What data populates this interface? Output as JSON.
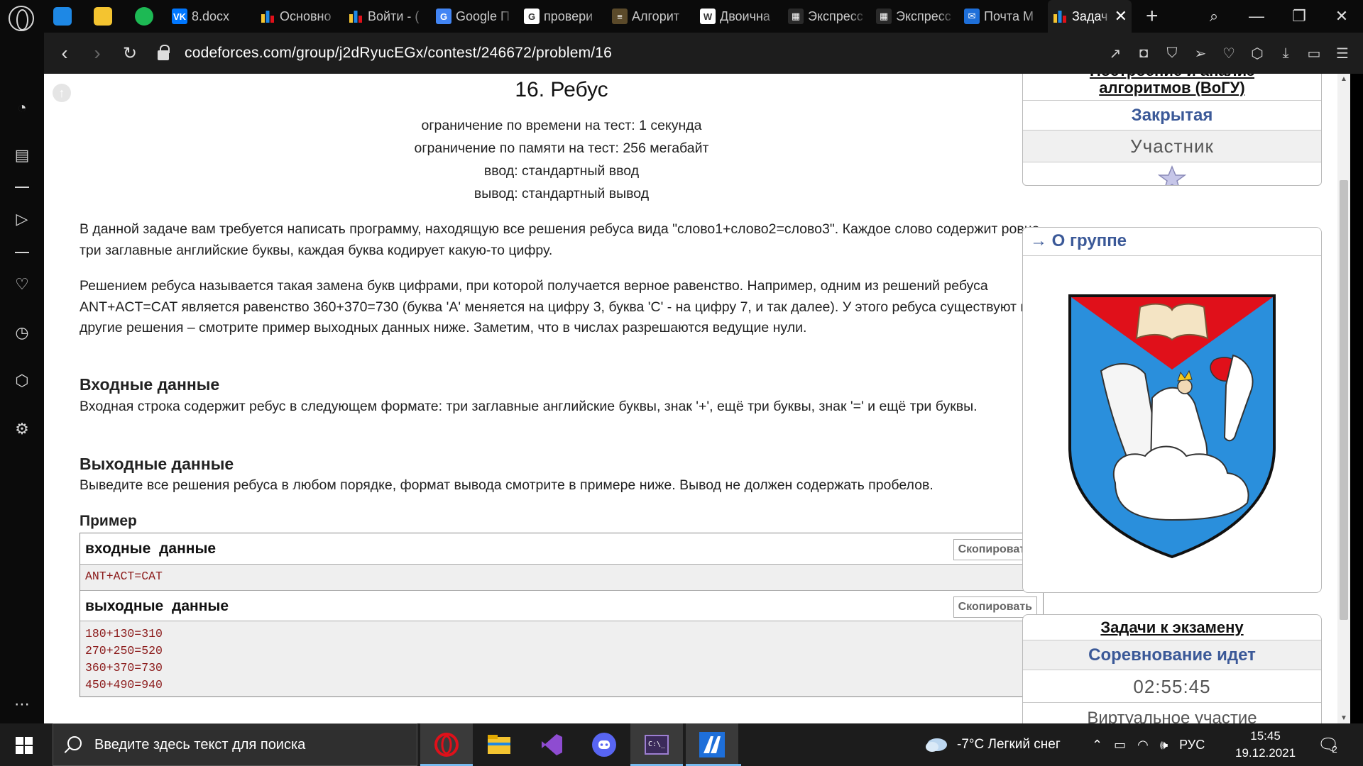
{
  "browser": {
    "tabs": [
      {
        "title": "8.docx",
        "icon": "vk-icon",
        "color": "#0077ff",
        "glyph": "VK"
      },
      {
        "title": "Основно",
        "icon": "codeforces-icon",
        "color": "#1a1a1a",
        "glyph": ""
      },
      {
        "title": "Войти - (",
        "icon": "codeforces-icon",
        "color": "#1a1a1a",
        "glyph": ""
      },
      {
        "title": "Google П",
        "icon": "google-translate-icon",
        "color": "#4285f4",
        "glyph": "G"
      },
      {
        "title": "провери",
        "icon": "google-icon",
        "color": "#ffffff",
        "glyph": "G"
      },
      {
        "title": "Алгорит",
        "icon": "algorithm-site-icon",
        "color": "#5b4a2a",
        "glyph": "≡"
      },
      {
        "title": "Двоична",
        "icon": "wikipedia-icon",
        "color": "#ffffff",
        "glyph": "W"
      },
      {
        "title": "Экспресс",
        "icon": "grid-icon",
        "color": "#2a2a2a",
        "glyph": "▦"
      },
      {
        "title": "Экспресс",
        "icon": "grid-icon",
        "color": "#2a2a2a",
        "glyph": "▦"
      },
      {
        "title": "Почта М",
        "icon": "mail-icon",
        "color": "#1e6fd9",
        "glyph": "✉"
      },
      {
        "title": "Задач",
        "icon": "codeforces-icon",
        "color": "#1a1a1a",
        "glyph": "",
        "active": true
      }
    ],
    "url": "codeforces.com/group/j2dRyucEGx/contest/246672/problem/16"
  },
  "problem": {
    "title": "16. Ребус",
    "time_limit": "ограничение по времени на тест: 1 секунда",
    "memory_limit": "ограничение по памяти на тест: 256 мегабайт",
    "input": "ввод: стандартный ввод",
    "output": "вывод: стандартный вывод",
    "legend_1": "В данной задаче вам требуется написать программу, находящую все решения ребуса вида \"слово1+слово2=слово3\". Каждое слово содержит ровно три заглавные английские буквы, каждая буква кодирует какую-то цифру.",
    "legend_2": "Решением ребуса называется такая замена букв цифрами, при которой получается верное равенство. Например, одним из решений ребуса ANT+ACT=CAT является равенство 360+370=730 (буква 'A' меняется на цифру 3, буква 'C' - на цифру 7, и так далее). У этого ребуса существуют и другие решения – смотрите пример выходных данных ниже. Заметим, что в числах разрешаются ведущие нули.",
    "input_title": "Входные данные",
    "input_text": "Входная строка содержит ребус в следующем формате: три заглавные английские буквы, знак '+', ещё три буквы, знак '=' и ещё три буквы.",
    "output_title": "Выходные данные",
    "output_text": "Выведите все решения ребуса в любом порядке, формат вывода смотрите в примере ниже. Вывод не должен содержать пробелов.",
    "example_title": "Пример",
    "example_input_label": "входные данные",
    "example_output_label": "выходные данные",
    "copy_label": "Скопировать",
    "example_input": [
      "ANT+ACT=CAT"
    ],
    "example_output": [
      "180+130=310",
      "270+250=520",
      "360+370=730",
      "450+490=940"
    ]
  },
  "sidebar_right": {
    "group_name_partial": "Построение и анализ",
    "group_name_line2": "алгоритмов (ВоГУ)",
    "access": "Закрытая",
    "role": "Участник",
    "about_title": "→ О группе",
    "contest_title": "Задачи к экзамену",
    "contest_status": "Соревнование идет",
    "timer": "02:55:45",
    "virtual_partial": "Виртуальное участие"
  },
  "taskbar": {
    "search_placeholder": "Введите здесь текст для поиска",
    "weather": "-7°C  Легкий снег",
    "language": "РУС",
    "time": "15:45",
    "date": "19.12.2021",
    "notifications": "2"
  },
  "colors": {
    "cf_blue": "#3b5998",
    "sample_text": "#8b1a1a",
    "shield_blue": "#2a8fdc",
    "shield_red": "#e0101a"
  }
}
